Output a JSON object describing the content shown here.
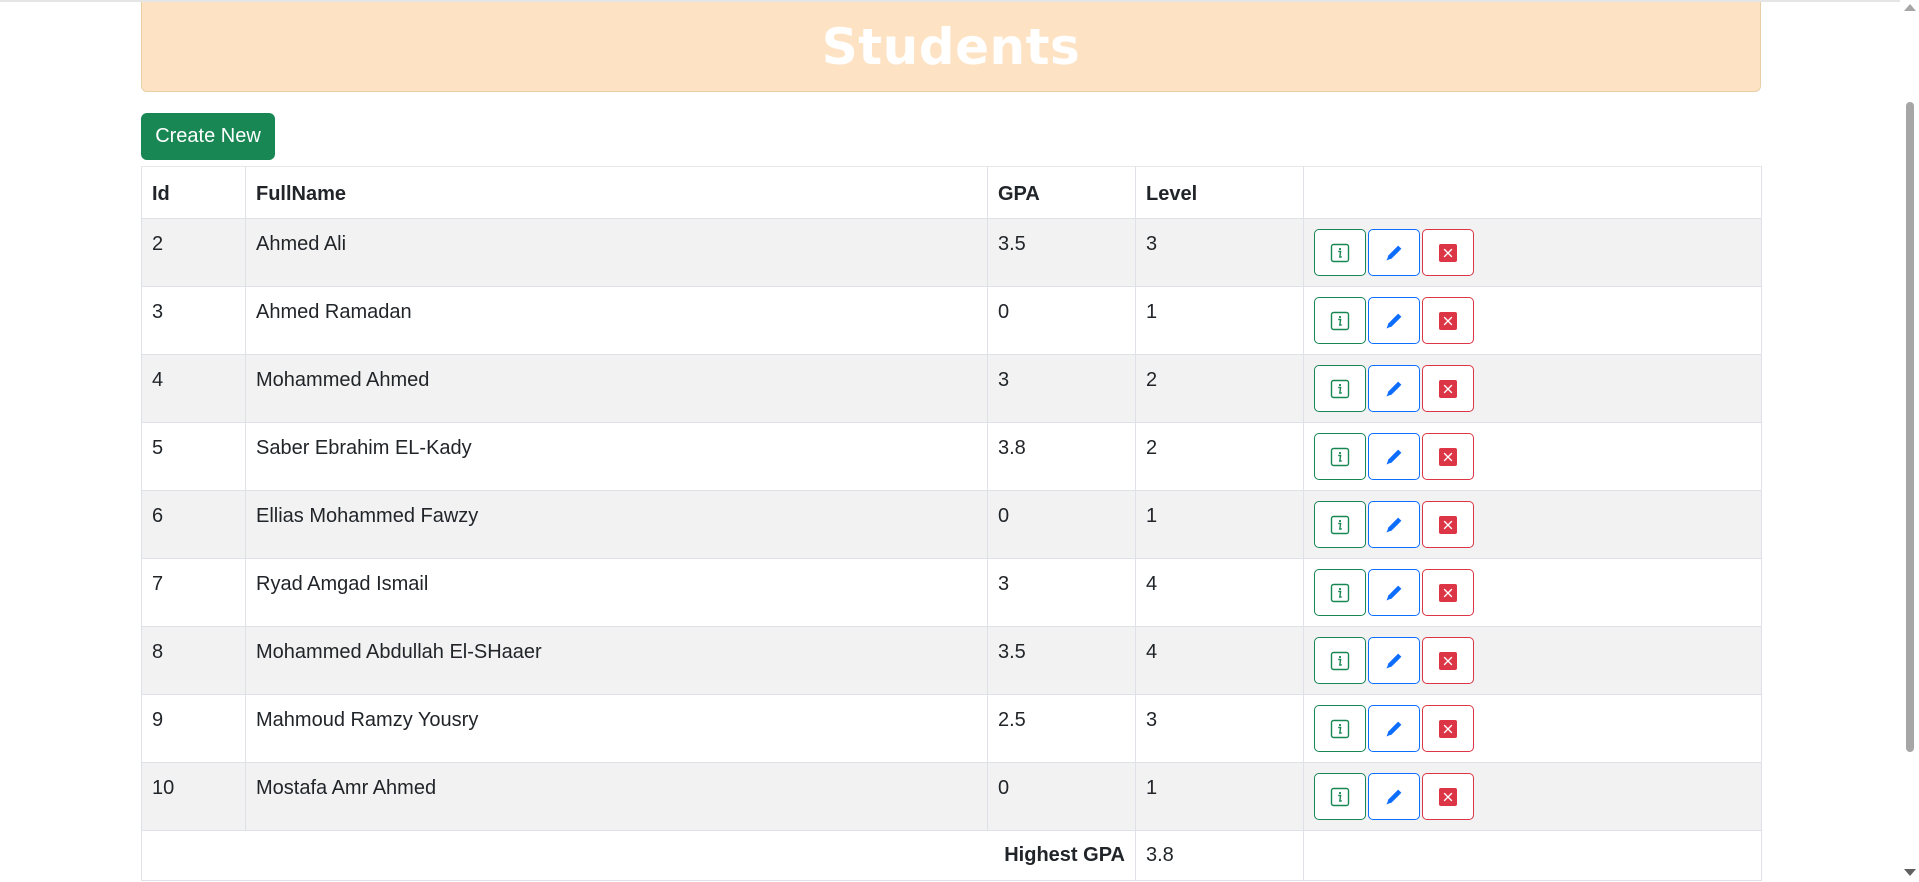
{
  "page": {
    "title": "Students",
    "create_label": "Create New"
  },
  "table": {
    "headers": {
      "id": "Id",
      "fullname": "FullName",
      "gpa": "GPA",
      "level": "Level"
    },
    "rows": [
      {
        "id": "2",
        "name": "Ahmed Ali",
        "gpa": "3.5",
        "level": "3"
      },
      {
        "id": "3",
        "name": "Ahmed Ramadan",
        "gpa": "0",
        "level": "1"
      },
      {
        "id": "4",
        "name": "Mohammed Ahmed",
        "gpa": "3",
        "level": "2"
      },
      {
        "id": "5",
        "name": "Saber Ebrahim EL-Kady",
        "gpa": "3.8",
        "level": "2"
      },
      {
        "id": "6",
        "name": "Ellias Mohammed Fawzy",
        "gpa": "0",
        "level": "1"
      },
      {
        "id": "7",
        "name": "Ryad Amgad Ismail",
        "gpa": "3",
        "level": "4"
      },
      {
        "id": "8",
        "name": "Mohammed Abdullah El-SHaaer",
        "gpa": "3.5",
        "level": "4"
      },
      {
        "id": "9",
        "name": "Mahmoud Ramzy Yousry",
        "gpa": "2.5",
        "level": "3"
      },
      {
        "id": "10",
        "name": "Mostafa Amr Ahmed",
        "gpa": "0",
        "level": "1"
      }
    ],
    "footer": {
      "label": "Highest GPA",
      "value": "3.8"
    }
  },
  "icons": {
    "details": "info-icon",
    "edit": "pencil-icon",
    "delete": "x-icon"
  },
  "colors": {
    "banner_bg": "#fde3c3",
    "primary_green": "#198754",
    "edit_blue": "#0d6efd",
    "delete_red": "#dc3545"
  }
}
